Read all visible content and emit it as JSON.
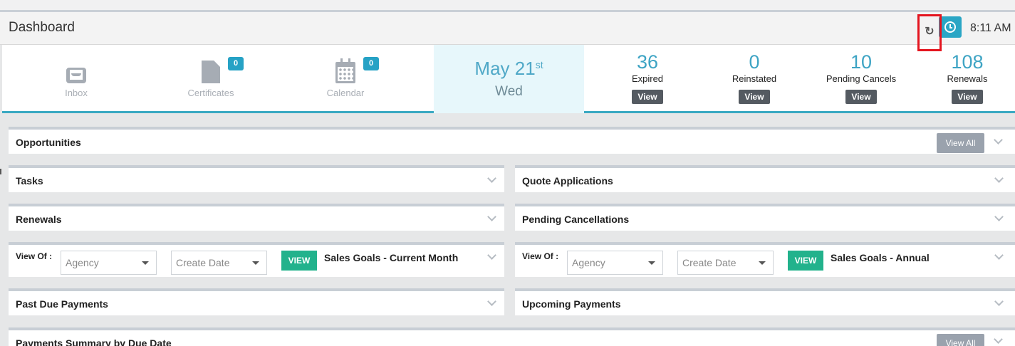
{
  "header": {
    "title": "Dashboard",
    "time": "8:11 AM",
    "refresh_glyph": "↻",
    "icons": {
      "refresh": "refresh-link-icon",
      "clock": "clock-icon"
    }
  },
  "quick_links": [
    {
      "label": "Inbox",
      "icon": "inbox-icon"
    },
    {
      "label": "Certificates",
      "badge": "0",
      "icon": "certificate-icon"
    },
    {
      "label": "Calendar",
      "badge": "0",
      "icon": "calendar-icon"
    }
  ],
  "date": {
    "month_day": "May 21",
    "suffix": "st",
    "weekday": "Wed"
  },
  "stats": [
    {
      "value": "36",
      "label": "Expired",
      "button": "View"
    },
    {
      "value": "0",
      "label": "Reinstated",
      "button": "View"
    },
    {
      "value": "10",
      "label": "Pending Cancels",
      "button": "View"
    },
    {
      "value": "108",
      "label": "Renewals",
      "button": "View"
    }
  ],
  "panels": {
    "opportunities": {
      "title": "Opportunities",
      "view_all": "View All"
    },
    "tasks": {
      "title": "Tasks"
    },
    "quote_applications": {
      "title": "Quote Applications"
    },
    "renewals": {
      "title": "Renewals"
    },
    "pending_cancellations": {
      "title": "Pending Cancellations"
    },
    "sales_month": {
      "view_of": "View Of :",
      "agency_placeholder": "Agency",
      "date_placeholder": "Create Date",
      "view_button": "VIEW",
      "title": "Sales Goals - Current Month"
    },
    "sales_annual": {
      "view_of": "View Of :",
      "agency_placeholder": "Agency",
      "date_placeholder": "Create Date",
      "view_button": "VIEW",
      "title": "Sales Goals - Annual"
    },
    "past_due": {
      "title": "Past Due Payments"
    },
    "upcoming": {
      "title": "Upcoming Payments"
    },
    "summary": {
      "title": "Payments Summary by Due Date",
      "view_all": "View All"
    }
  },
  "colors": {
    "accent": "#2aa6c5",
    "go_button": "#22b28c",
    "highlight": "#e4151f"
  }
}
